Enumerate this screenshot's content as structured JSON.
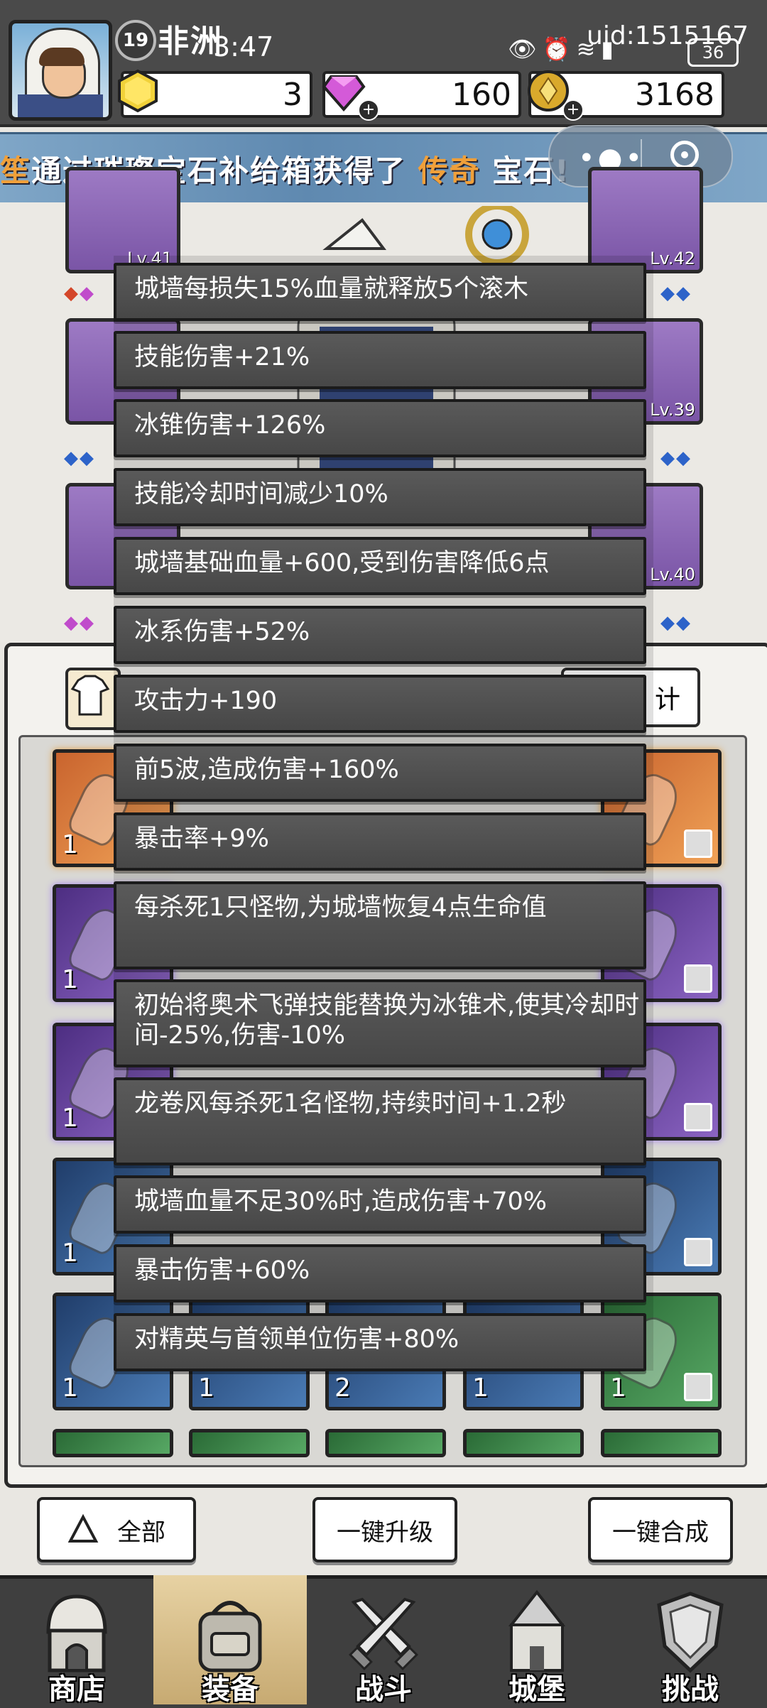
{
  "status_bar": {
    "time": "3:47",
    "uid": "uid:1515167",
    "battery": "36"
  },
  "player": {
    "level": "19",
    "name": "非洲"
  },
  "currencies": {
    "energy": "3",
    "diamonds": "160",
    "coins": "3168"
  },
  "banner": {
    "prefix": "笙",
    "middle": "通过璀璨宝石补给箱获得了",
    "highlight": "传奇",
    "suffix": "宝石!"
  },
  "equipment": [
    {
      "level": "Lv.41"
    },
    {
      "level": "Lv.42"
    },
    {
      "level": "Lv.39"
    },
    {
      "level": "Lv.40"
    }
  ],
  "panel": {
    "right_button_partial": "计"
  },
  "gem_counts": [
    "1",
    "1",
    "1",
    "1",
    "1",
    "1",
    "2",
    "1",
    "1"
  ],
  "tooltips": [
    "城墙每损失15%血量就释放5个滚木",
    "技能伤害+21%",
    "冰锥伤害+126%",
    "技能冷却时间减少10%",
    "城墙基础血量+600,受到伤害降低6点",
    "冰系伤害+52%",
    "攻击力+190",
    "前5波,造成伤害+160%",
    "暴击率+9%",
    "每杀死1只怪物,为城墙恢复4点生命值",
    "初始将奥术飞弹技能替换为冰锥术,使其冷却时间-25%,伤害-10%",
    "龙卷风每杀死1名怪物,持续时间+1.2秒",
    "城墙血量不足30%时,造成伤害+70%",
    "暴击伤害+60%",
    "对精英与首领单位伤害+80%"
  ],
  "actions": {
    "filter_all": "全部",
    "upgrade_all": "一键升级",
    "merge_all": "一键合成"
  },
  "nav": [
    {
      "label": "商店",
      "icon": "shop-icon"
    },
    {
      "label": "装备",
      "icon": "backpack-icon"
    },
    {
      "label": "战斗",
      "icon": "crossed-swords-icon"
    },
    {
      "label": "城堡",
      "icon": "castle-icon"
    },
    {
      "label": "挑战",
      "icon": "challenge-shield-icon"
    }
  ],
  "colors": {
    "legendary_highlight": "#f0a03a",
    "tooltip_bg": "#4f4f4f",
    "nav_active": "#d8bf88"
  }
}
